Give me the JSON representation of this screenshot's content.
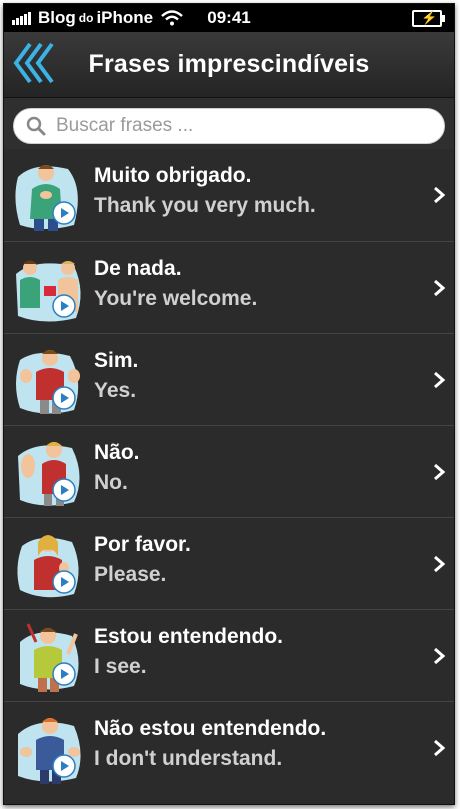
{
  "status_bar": {
    "carrier_main": "Blog",
    "carrier_small": "do",
    "carrier_device": "iPhone",
    "time": "09:41"
  },
  "nav": {
    "title": "Frases imprescindíveis",
    "back_icon": "double-chevron-left-icon"
  },
  "search": {
    "placeholder": "Buscar frases ..."
  },
  "colors": {
    "accent": "#3ab4e6",
    "background": "#2b2b2b",
    "thumb_bg": "#bfe3ef"
  },
  "phrases": [
    {
      "phrase": "Muito obrigado.",
      "translation": "Thank you very much.",
      "icon": "thank-you-person-icon"
    },
    {
      "phrase": "De nada.",
      "translation": "You're welcome.",
      "icon": "welcome-people-icon"
    },
    {
      "phrase": "Sim.",
      "translation": "Yes.",
      "icon": "thumbs-up-person-icon"
    },
    {
      "phrase": "Não.",
      "translation": "No.",
      "icon": "no-gesture-person-icon"
    },
    {
      "phrase": "Por favor.",
      "translation": "Please.",
      "icon": "please-gesture-person-icon"
    },
    {
      "phrase": "Estou entendendo.",
      "translation": "I see.",
      "icon": "understanding-person-icon"
    },
    {
      "phrase": "Não estou entendendo.",
      "translation": "I don't understand.",
      "icon": "confused-person-icon"
    }
  ]
}
